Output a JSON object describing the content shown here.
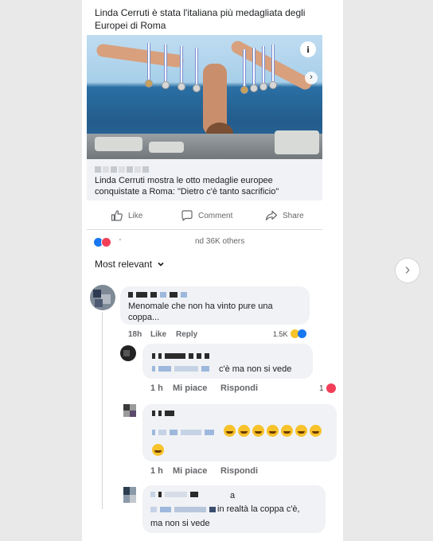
{
  "post": {
    "headline": "Linda Cerruti è stata l'italiana più medagliata degli Europei di Roma",
    "info_glyph": "i",
    "carousel_glyph": "›",
    "link_title": "Linda Cerruti mostra le otto medaglie europee conquistate a Roma: \"Dietro c'è tanto sacrificio\""
  },
  "actions": {
    "like": "Like",
    "comment": "Comment",
    "share": "Share"
  },
  "reactions": {
    "prefix_glyph": "'",
    "text": "nd 36K others"
  },
  "sort_label": "Most relevant",
  "comments": [
    {
      "text": "Menomale che non ha vinto pure una coppa...",
      "time": "18h",
      "like": "Like",
      "reply": "Reply",
      "like_count": "1.5K"
    },
    {
      "text_tail": "c'è ma non si vede",
      "time": "1 h",
      "like": "Mi piace",
      "reply": "Rispondi",
      "like_count": "1"
    },
    {
      "time": "1 h",
      "like": "Mi piace",
      "reply": "Rispondi",
      "emoji_count": 8
    },
    {
      "name_tail": "a",
      "text_line1": "in realtà la coppa c'è,",
      "text_line2": "ma non si vede"
    }
  ],
  "page_next_glyph": "›",
  "colors": {
    "facebook_blue": "#1877f2",
    "love_red": "#f33e58",
    "bubble_gray": "#f0f2f5"
  }
}
